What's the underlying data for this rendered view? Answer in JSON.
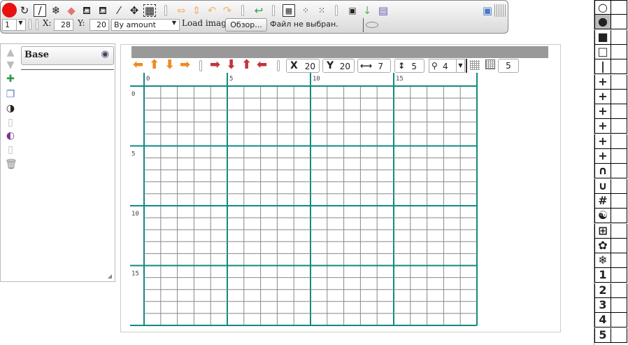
{
  "toolbar": {
    "size_select": "1",
    "x_label": "X:",
    "x_value": "28",
    "y_label": "Y:",
    "y_value": "20",
    "mode_select": "By amount",
    "load_image_label": "Load image",
    "browse_button": "Обзор...",
    "file_status": "Файл не выбран."
  },
  "layers": {
    "base_name": "Base"
  },
  "canvas_controls": {
    "x_label": "X",
    "x_value": "20",
    "y_label": "Y",
    "y_value": "20",
    "width_value": "7",
    "height_value": "5",
    "zoom_value": "4",
    "grid_value": "5"
  },
  "grid": {
    "cols": 20,
    "rows": 20,
    "major_every": 5,
    "col_labels": [
      "0",
      "5",
      "10",
      "15"
    ],
    "row_labels": [
      "0",
      "5",
      "10",
      "15"
    ],
    "line_color": "#888888",
    "major_color": "#138a80"
  },
  "palette": {
    "symbols": [
      "○",
      "●",
      "■",
      "□",
      "|",
      "+",
      "+",
      "+",
      "+",
      "+",
      "+",
      "∩",
      "∪",
      "#",
      "☯",
      "⊞",
      "✿",
      "❄",
      "1",
      "2",
      "3",
      "4",
      "5"
    ]
  },
  "colors": {
    "record_red": "#e81010",
    "arrow_orange": "#f08a1e",
    "arrow_red": "#c2343a",
    "undo_green": "#2e9a48",
    "save_blue": "#4a78c4"
  }
}
